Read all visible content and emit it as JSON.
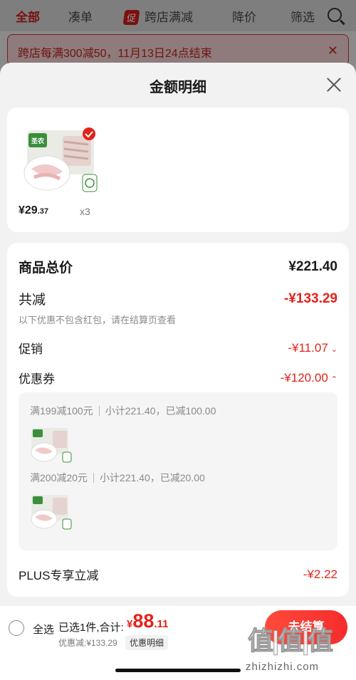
{
  "background": {
    "tabs": [
      "全部",
      "凑单",
      "跨店满减",
      "降价",
      "筛选"
    ],
    "promo_tag": "促",
    "banner_text": "跨店每满300减50，11月13日24点结束"
  },
  "sheet": {
    "title": "金额明细",
    "product": {
      "brand_text": "圣农",
      "price_symbol": "¥",
      "price_int": "29",
      "price_dec": ".37",
      "quantity": "x3"
    },
    "summary": {
      "goods_total_label": "商品总价",
      "goods_total_value": "¥221.40",
      "total_reduce_label": "共减",
      "total_reduce_value": "-¥133.29",
      "note": "以下优惠不包含红包，请在结算页查看",
      "promo_label": "促销",
      "promo_value": "-¥11.07",
      "coupon_label": "优惠券",
      "coupon_value": "-¥120.00",
      "coupons": [
        {
          "rule": "满199减100元",
          "detail": "小计221.40，已减100.00"
        },
        {
          "rule": "满200减20元",
          "detail": "小计221.40，已减20.00"
        }
      ],
      "plus_label": "PLUS专享立减",
      "plus_value": "-¥2.22"
    }
  },
  "bottom_bar": {
    "select_all": "全选",
    "selected_text": "已选1件,合计:",
    "total_symbol": "¥",
    "total_int": "88",
    "total_dec": ".11",
    "discount_text": "优惠减:¥133.29",
    "detail_button": "优惠明细",
    "checkout_button": "去结算",
    "watermark": "值|值|值",
    "watermark_url": "zhizhizhi.com"
  },
  "colors": {
    "accent": "#e2231a",
    "overlay": "#8a8a8a"
  }
}
